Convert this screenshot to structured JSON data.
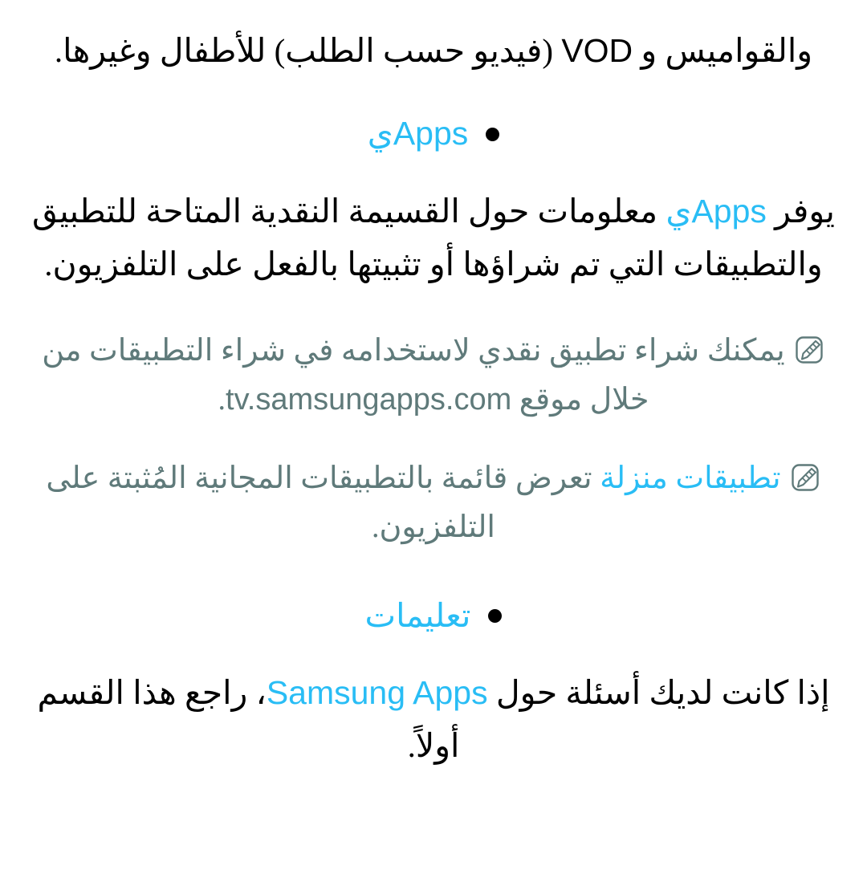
{
  "document": {
    "language": "ar",
    "direction": "rtl",
    "background_color": "#ffffff",
    "body_text_color": "#000000",
    "accent_color": "#29bdf5",
    "note_text_color": "#5f7a7a"
  },
  "intro": {
    "continued_line_prefix": "والقواميس و ",
    "continued_line_latin": "VOD",
    "continued_line_suffix": " (فيديو حسب الطلب) للأطفال وغيرها."
  },
  "sections": [
    {
      "bullet_icon": "bullet-dot",
      "heading_latin": "Apps",
      "heading_arabic_suffix": "ي",
      "paragraph": {
        "before": "يوفر ",
        "latin": "Apps",
        "arabic_tail": "ي",
        "after": " معلومات حول القسيمة النقدية المتاحة للتطبيق والتطبيقات التي تم شراؤها أو تثبيتها بالفعل على التلفزيون."
      },
      "notes": [
        {
          "icon": "note-pencil-icon",
          "text_before": "يمكنك شراء تطبيق نقدي لاستخدامه في شراء التطبيقات من خلال موقع ",
          "url": "tv.samsungapps.com",
          "text_after": "."
        },
        {
          "icon": "note-pencil-icon",
          "accent_text": "تطبيقات منزلة",
          "text_after": " تعرض قائمة بالتطبيقات المجانية المُثبتة على التلفزيون."
        }
      ]
    },
    {
      "bullet_icon": "bullet-dot",
      "heading_arabic": "تعليمات",
      "paragraph": {
        "before": "إذا كانت لديك أسئلة حول ",
        "latin_accent": "Samsung Apps",
        "after": "، راجع هذا القسم أولاً."
      }
    }
  ]
}
